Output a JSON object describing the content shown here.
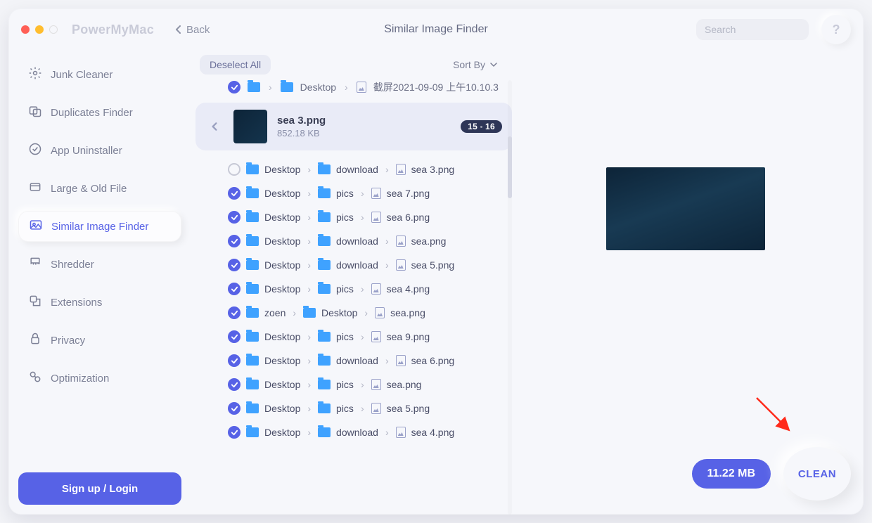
{
  "header": {
    "brand": "PowerMyMac",
    "back_label": "Back",
    "title": "Similar Image Finder",
    "search_placeholder": "Search",
    "help": "?"
  },
  "sidebar": {
    "items": [
      {
        "label": "Junk Cleaner"
      },
      {
        "label": "Duplicates Finder"
      },
      {
        "label": "App Uninstaller"
      },
      {
        "label": "Large & Old File"
      },
      {
        "label": "Similar Image Finder"
      },
      {
        "label": "Shredder"
      },
      {
        "label": "Extensions"
      },
      {
        "label": "Privacy"
      },
      {
        "label": "Optimization"
      }
    ],
    "active_index": 4,
    "login_label": "Sign up / Login"
  },
  "toolbar": {
    "deselect_label": "Deselect All",
    "sort_label": "Sort By"
  },
  "partial_top": {
    "checked": true,
    "segments": [
      "Desktop",
      "截屏2021-09-09 上午10.10.3"
    ]
  },
  "group": {
    "title": "sea 3.png",
    "size": "852.18 KB",
    "badge_sel": "15",
    "badge_tot": "16"
  },
  "rows": [
    {
      "checked": false,
      "path": [
        "Desktop",
        "download",
        "sea 3.png"
      ]
    },
    {
      "checked": true,
      "path": [
        "Desktop",
        "pics",
        "sea 7.png"
      ]
    },
    {
      "checked": true,
      "path": [
        "Desktop",
        "pics",
        "sea 6.png"
      ]
    },
    {
      "checked": true,
      "path": [
        "Desktop",
        "download",
        "sea.png"
      ]
    },
    {
      "checked": true,
      "path": [
        "Desktop",
        "download",
        "sea 5.png"
      ]
    },
    {
      "checked": true,
      "path": [
        "Desktop",
        "pics",
        "sea 4.png"
      ]
    },
    {
      "checked": true,
      "path": [
        "zoen",
        "Desktop",
        "sea.png"
      ]
    },
    {
      "checked": true,
      "path": [
        "Desktop",
        "pics",
        "sea 9.png"
      ]
    },
    {
      "checked": true,
      "path": [
        "Desktop",
        "download",
        "sea 6.png"
      ]
    },
    {
      "checked": true,
      "path": [
        "Desktop",
        "pics",
        "sea.png"
      ]
    },
    {
      "checked": true,
      "path": [
        "Desktop",
        "pics",
        "sea 5.png"
      ]
    },
    {
      "checked": true,
      "path": [
        "Desktop",
        "download",
        "sea 4.png"
      ]
    }
  ],
  "footer": {
    "size": "11.22 MB",
    "clean_label": "CLEAN"
  }
}
